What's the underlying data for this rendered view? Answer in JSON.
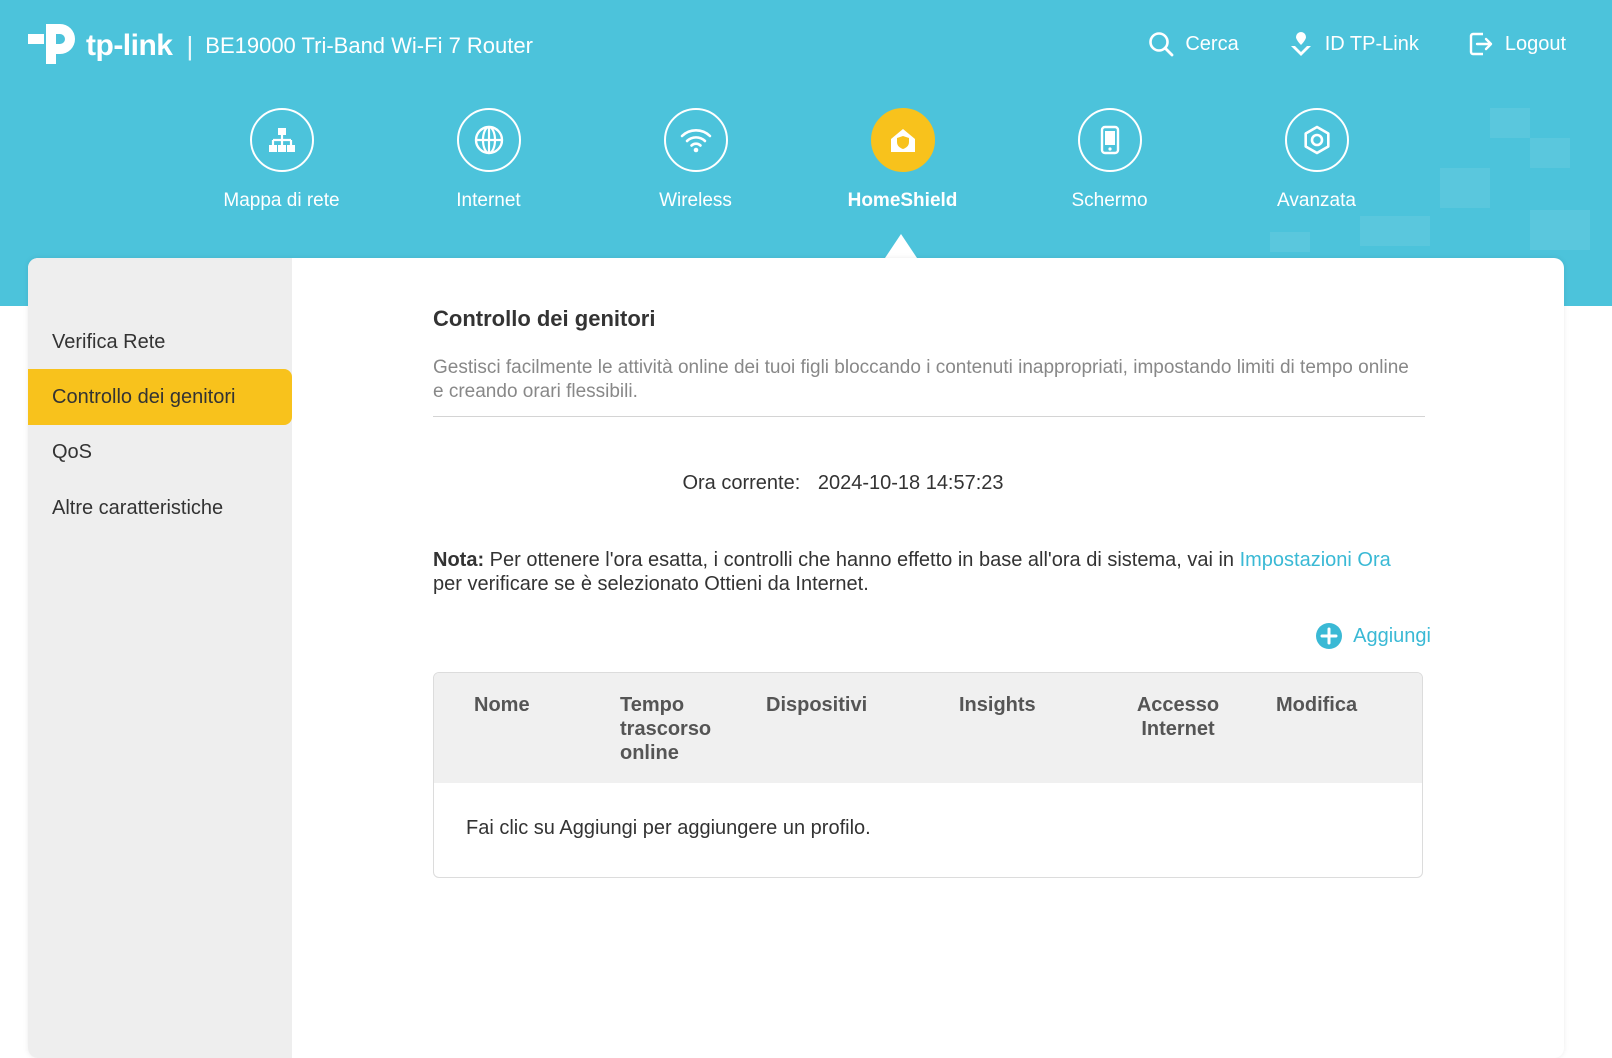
{
  "header": {
    "brand": "tp-link",
    "separator": "|",
    "model": "BE19000 Tri-Band Wi-Fi 7 Router",
    "links": [
      {
        "label": "Cerca",
        "icon": "search-icon"
      },
      {
        "label": "ID TP-Link",
        "icon": "tplink-id-icon"
      },
      {
        "label": "Logout",
        "icon": "logout-icon"
      }
    ]
  },
  "nav": {
    "items": [
      {
        "label": "Mappa di rete",
        "icon": "network-map-icon"
      },
      {
        "label": "Internet",
        "icon": "globe-icon"
      },
      {
        "label": "Wireless",
        "icon": "wifi-icon"
      },
      {
        "label": "HomeShield",
        "icon": "homeshield-icon",
        "active": true
      },
      {
        "label": "Schermo",
        "icon": "tablet-icon"
      },
      {
        "label": "Avanzata",
        "icon": "gear-icon"
      }
    ]
  },
  "sidebar": {
    "items": [
      {
        "label": "Verifica Rete"
      },
      {
        "label": "Controllo dei genitori",
        "active": true
      },
      {
        "label": "QoS"
      },
      {
        "label": "Altre caratteristiche"
      }
    ]
  },
  "main": {
    "title": "Controllo dei genitori",
    "description": "Gestisci facilmente le attività online dei tuoi figli bloccando i contenuti inappropriati, impostando limiti di tempo online e creando orari flessibili.",
    "current_time_label": "Ora corrente:",
    "current_time_value": "2024-10-18 14:57:23",
    "note_bold": "Nota:",
    "note_text": " Per ottenere l'ora esatta, i controlli che hanno effetto in base all'ora di sistema, vai in ",
    "note_link": "Impostazioni Ora",
    "note_tail": " per verificare se è selezionato Ottieni da Internet.",
    "add_label": "Aggiungi",
    "table": {
      "columns": [
        "Nome",
        "Tempo trascorso online",
        "Dispositivi",
        "Insights",
        "Accesso Internet",
        "Modifica"
      ],
      "empty_message": "Fai clic su Aggiungi per aggiungere un profilo."
    }
  },
  "colors": {
    "header_bg": "#4cc3db",
    "accent_yellow": "#f8c21c",
    "link": "#3ab9d5",
    "sidebar_bg": "#eeeeee"
  }
}
